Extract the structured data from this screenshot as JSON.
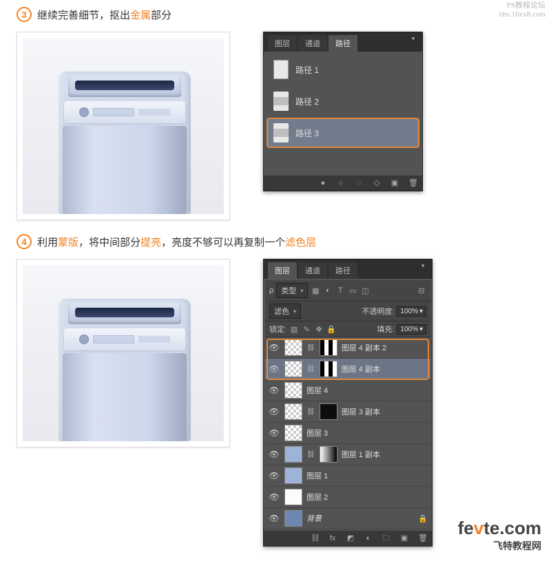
{
  "watermarks": {
    "top1": "PS教程论坛",
    "top2": "bbs.16xx8.com",
    "brand_prefix": "fe",
    "brand_accent": "v",
    "brand_suffix": "te.com",
    "brand_sub": "飞特教程网"
  },
  "step3": {
    "num": "3",
    "t1": "继续完善细节，抠出",
    "t2": "金属",
    "t3": "部分"
  },
  "step4": {
    "num": "4",
    "t1": "利用",
    "t2": "蒙版",
    "t3": "，将中间部分",
    "t4": "提亮",
    "t5": "，亮度不够可以再复制一个",
    "t6": "滤色层"
  },
  "pathsPanel": {
    "tabs": {
      "layers": "图层",
      "channels": "通道",
      "paths": "路径"
    },
    "items": [
      {
        "label": "路径 1"
      },
      {
        "label": "路径 2"
      },
      {
        "label": "路径 3"
      }
    ]
  },
  "layersPanel": {
    "tabs": {
      "layers": "图层",
      "channels": "通道",
      "paths": "路径"
    },
    "kind": "类型",
    "blend": "滤色",
    "opacityLabel": "不透明度:",
    "opacityVal": "100%",
    "lockLabel": "锁定:",
    "fillLabel": "填充:",
    "fillVal": "100%",
    "items": [
      {
        "label": "图层 4 副本 2"
      },
      {
        "label": "图层 4 副本"
      },
      {
        "label": "图层 4"
      },
      {
        "label": "图层 3 副本"
      },
      {
        "label": "图层 3"
      },
      {
        "label": "图层 1 副本"
      },
      {
        "label": "图层 1"
      },
      {
        "label": "图层 2"
      },
      {
        "label": "背景"
      }
    ]
  }
}
